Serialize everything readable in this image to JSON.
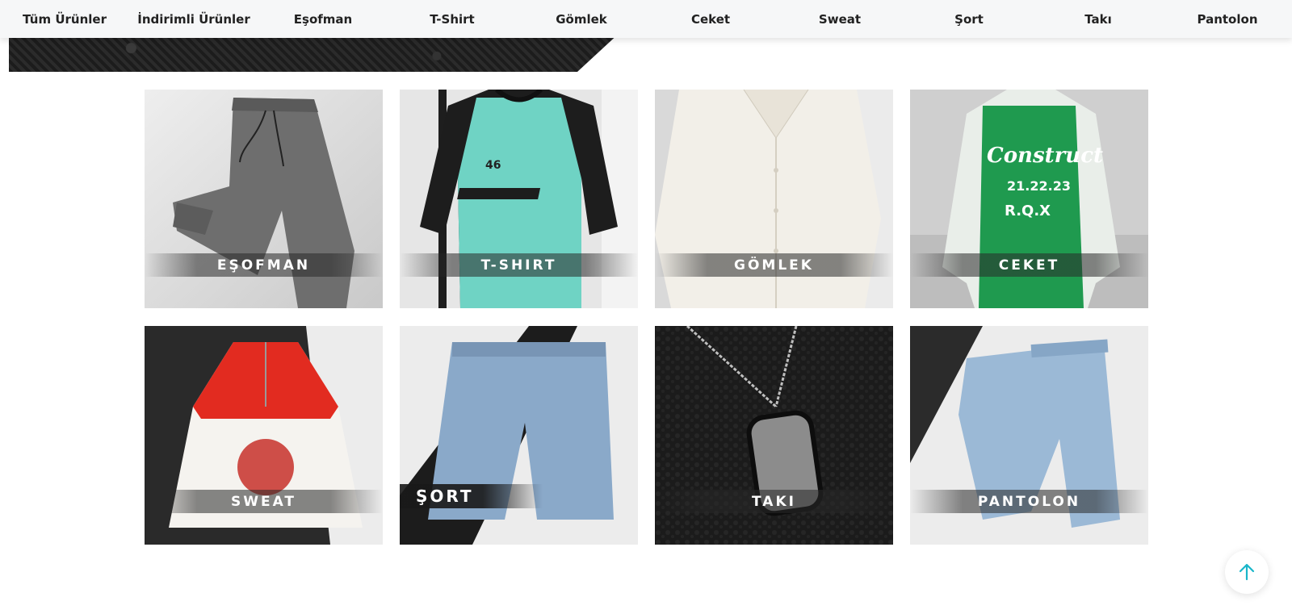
{
  "nav": {
    "items": [
      {
        "label": "Tüm Ürünler"
      },
      {
        "label": "İndirimli Ürünler"
      },
      {
        "label": "Eşofman"
      },
      {
        "label": "T-Shirt"
      },
      {
        "label": "Gömlek"
      },
      {
        "label": "Ceket"
      },
      {
        "label": "Sweat"
      },
      {
        "label": "Şort"
      },
      {
        "label": "Takı"
      },
      {
        "label": "Pantolon"
      }
    ]
  },
  "categories": [
    {
      "label": "EŞOFMAN"
    },
    {
      "label": "T-SHIRT"
    },
    {
      "label": "GÖMLEK"
    },
    {
      "label": "CEKET"
    },
    {
      "label": "SWEAT"
    },
    {
      "label": "ŞORT"
    },
    {
      "label": "TAKI"
    },
    {
      "label": "PANTOLON"
    }
  ],
  "colors": {
    "nav_bg": "#f6f7f8",
    "accent": "#19b6c9"
  },
  "icons": {
    "scroll_top": "arrow-up-icon"
  }
}
